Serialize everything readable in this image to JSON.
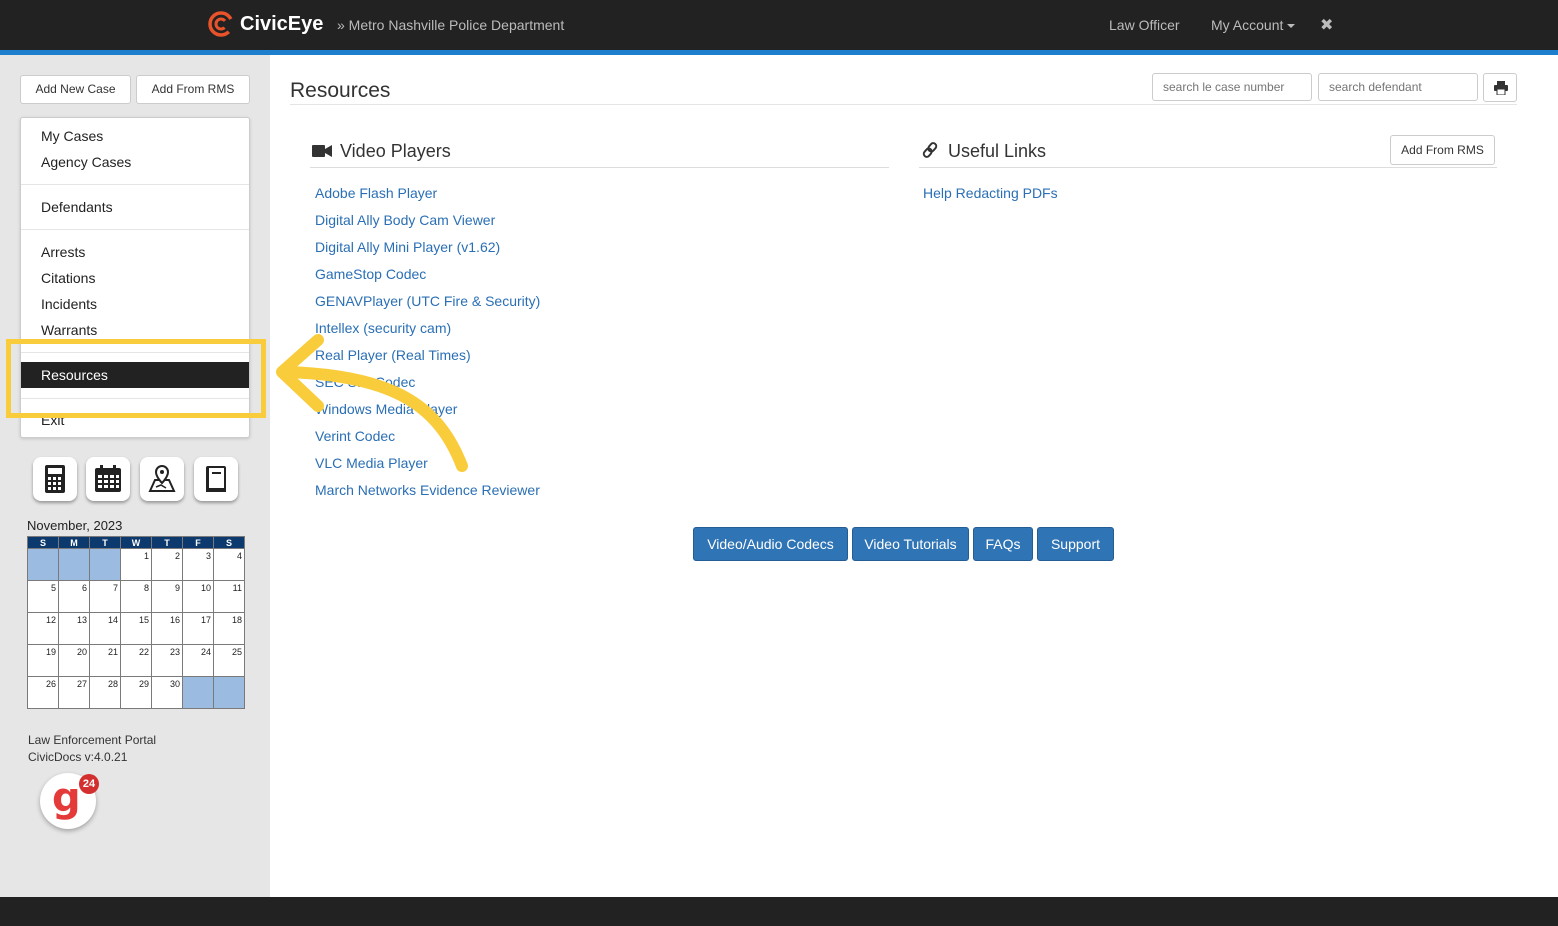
{
  "topnav": {
    "brand": "CivicEye",
    "department": "» Metro Nashville Police Department",
    "law_officer": "Law Officer",
    "my_account": "My Account",
    "close_glyph": "✖",
    "accent_color": "#1f7fcf"
  },
  "sidebar": {
    "add_new_case": "Add New Case",
    "add_from_rms": "Add From RMS",
    "menu": {
      "my_cases": "My Cases",
      "agency_cases": "Agency Cases",
      "defendants": "Defendants",
      "arrests": "Arrests",
      "citations": "Citations",
      "incidents": "Incidents",
      "warrants": "Warrants",
      "resources": "Resources",
      "exit": "Exit"
    },
    "tools": [
      "calculator-icon",
      "calendar-icon",
      "map-icon",
      "book-icon"
    ],
    "calendar": {
      "title": "November, 2023",
      "days": [
        "S",
        "M",
        "T",
        "W",
        "T",
        "F",
        "S"
      ],
      "weeks": [
        [
          "",
          "",
          "",
          "1",
          "2",
          "3",
          "4"
        ],
        [
          "5",
          "6",
          "7",
          "8",
          "9",
          "10",
          "11"
        ],
        [
          "12",
          "13",
          "14",
          "15",
          "16",
          "17",
          "18"
        ],
        [
          "19",
          "20",
          "21",
          "22",
          "23",
          "24",
          "25"
        ],
        [
          "26",
          "27",
          "28",
          "29",
          "30",
          "",
          ""
        ]
      ]
    },
    "footer": {
      "portal": "Law Enforcement Portal",
      "version": "CivicDocs v:4.0.21"
    },
    "g_badge_count": "24"
  },
  "main": {
    "title": "Resources",
    "search_case_placeholder": "search le case number",
    "search_defendant_placeholder": "search defendant",
    "video_players": {
      "title": "Video Players",
      "links": [
        "Adobe Flash Player",
        "Digital Ally Body Cam Viewer",
        "Digital Ally Mini Player (v1.62)",
        "GameStop Codec",
        "GENAVPlayer (UTC Fire & Security)",
        "Intellex (security cam)",
        "Real Player (Real Times)",
        "SEC SIR Codec",
        "Windows Media Player",
        "Verint Codec",
        "VLC Media Player",
        "March Networks Evidence Reviewer"
      ]
    },
    "useful_links": {
      "title": "Useful Links",
      "add_from_rms": "Add From RMS",
      "links": [
        "Help Redacting PDFs"
      ]
    },
    "buttons": {
      "codecs": "Video/Audio Codecs",
      "tutorials": "Video Tutorials",
      "faqs": "FAQs",
      "support": "Support"
    }
  },
  "colors": {
    "highlight": "#f9cc3b",
    "button_blue": "#2f74b5",
    "link_blue": "#2a6fb5",
    "calendar_header": "#0d3a6e",
    "calendar_pad": "#9bbbe0"
  }
}
